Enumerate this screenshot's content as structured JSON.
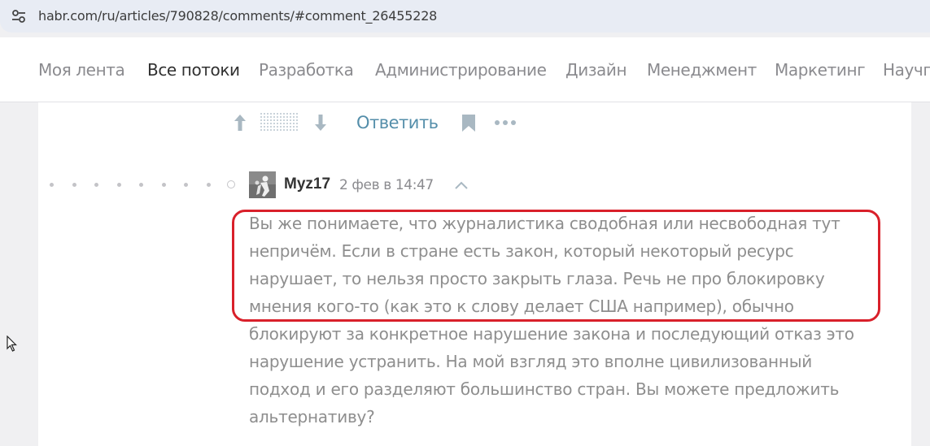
{
  "browser": {
    "url": "habr.com/ru/articles/790828/comments/#comment_26455228",
    "site_info_icon": "tune-icon"
  },
  "nav": {
    "items": [
      {
        "label": "Моя лента",
        "active": false
      },
      {
        "label": "Все потоки",
        "active": true
      },
      {
        "label": "Разработка",
        "active": false
      },
      {
        "label": "Администрирование",
        "active": false
      },
      {
        "label": "Дизайн",
        "active": false
      },
      {
        "label": "Менеджмент",
        "active": false
      },
      {
        "label": "Маркетинг",
        "active": false
      },
      {
        "label": "Научп",
        "active": false
      }
    ]
  },
  "prev_comment_actions": {
    "reply_label": "Ответить",
    "icons": [
      "arrow-up-icon",
      "score-hidden-icon",
      "arrow-down-icon",
      "bookmark-icon",
      "more-icon"
    ]
  },
  "comment": {
    "username": "Myz17",
    "date": "2 фев в 14:47",
    "lines": [
      "Вы же понимаете, что журналистика сводобная или несвободная тут",
      "непричём. Если в стране есть закон, который некоторый ресурс",
      "нарушает, то нельзя просто закрыть глаза. Речь не про блокировку",
      "мнения кого-то (как это к слову делает США например), обычно",
      "блокируют за конкретное нарушение закона и последующий отказ это",
      "нарушение устранить. На мой взгляд это вполне цивилизованный",
      "подход и его разделяют большинство стран. Вы можете предложить",
      "альтернативу?"
    ]
  },
  "colors": {
    "accent_link": "#548eaa",
    "highlight": "#d9202a",
    "muted_text": "#8e8e8e",
    "address_bar": "#e8ecf4"
  }
}
